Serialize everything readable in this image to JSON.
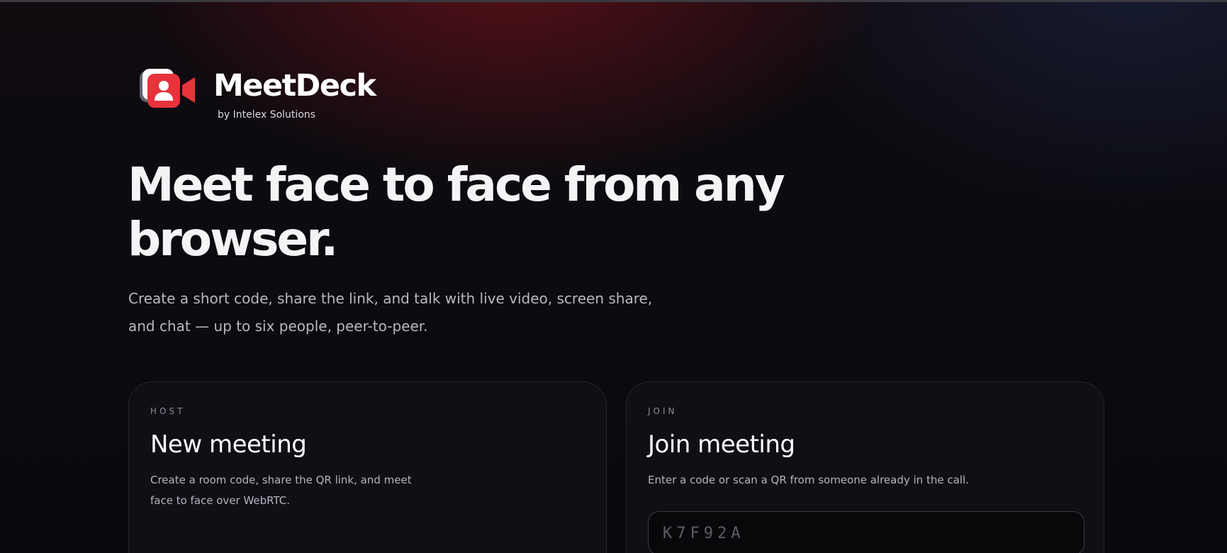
{
  "brand": {
    "name": "MeetDeck",
    "byline": "by Intelex Solutions",
    "accent": "#e8323c",
    "logo_icon": "video-camera-user-icon"
  },
  "hero": {
    "title": "Meet face to face from any browser.",
    "subtitle": "Create a short code, share the link, and talk with live video, screen share, and chat — up to six people, peer-to-peer."
  },
  "host_card": {
    "eyebrow": "HOST",
    "title": "New meeting",
    "description": "Create a room code, share the QR link, and meet face to face over WebRTC."
  },
  "join_card": {
    "eyebrow": "JOIN",
    "title": "Join meeting",
    "description": "Enter a code or scan a QR from someone already in the call.",
    "code_input": {
      "value": "",
      "placeholder": "K7F92A"
    }
  }
}
